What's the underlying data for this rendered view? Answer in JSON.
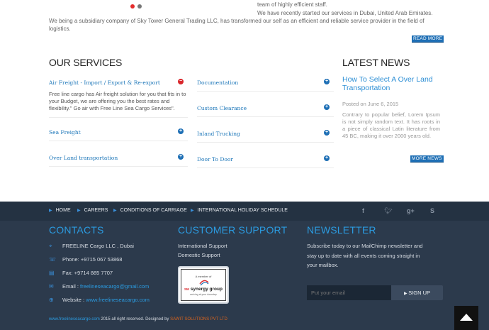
{
  "top": {
    "team_text": "team of highly efficient staff.",
    "about_line1": "We have recently started our services in Dubai, United Arab Emirates.",
    "about_line2": "We being a subsidiary company of Sky Tower General Trading LLC, has transformed our self as an efficient and reliable service provider in the field of logistics.",
    "read_more": "READ MORE"
  },
  "services": {
    "heading": "OUR SERVICES",
    "items": [
      {
        "title": "Air Freight - Import / Export & Re-export",
        "icon": "minus-circle-icon",
        "expanded": true,
        "desc": "Free line cargo has Air freight solution for you that fits in to your Budget, we are offering you the best rates and flexibility.\" Go air with Free Line Sea Cargo Services\"."
      },
      {
        "title": "Documentation",
        "icon": "plus-circle-icon"
      },
      {
        "title": "Custom Clearance",
        "icon": "plus-circle-icon"
      },
      {
        "title": "Sea Freight",
        "icon": "plus-circle-icon"
      },
      {
        "title": "Inland Trucking",
        "icon": "plus-circle-icon"
      },
      {
        "title": "Over Land transportation",
        "icon": "plus-circle-icon"
      },
      {
        "title": "Door To Door",
        "icon": "plus-circle-icon"
      }
    ]
  },
  "news": {
    "heading": "LATEST NEWS",
    "title": "How To Select A Over Land Transportation",
    "date": "Posted on June 6, 2015",
    "text": "Contrary to popular belief, Lorem Ipsum is not simply random text. It has roots in a piece of classical Latin literature from 45 BC, making it over 2000 years old.",
    "more": "MORE NEWS"
  },
  "footer": {
    "nav": [
      "HOME",
      "CAREERS",
      "CONDITIONS OF CARRIAGE",
      "INTERNATIONAL HOLIDAY SCHEDULE"
    ],
    "social_icons": [
      "facebook-icon",
      "twitter-icon",
      "google-plus-icon",
      "skype-icon"
    ],
    "contacts": {
      "heading": "CONTACTS",
      "company": "FREELINE Cargo LLC , Dubai",
      "phone": "Phone: +9715 067 53868",
      "fax": "Fax: +9714 885 7707",
      "email_label": "Email : ",
      "email": "freelineseacargo@gmail.com",
      "website_label": "Website : ",
      "website": "www.freelineseacargo.com"
    },
    "support": {
      "heading": "CUSTOMER SUPPORT",
      "links": [
        "International Support",
        "Domestic Support"
      ],
      "logo_top": "A member of",
      "logo_mark": "SM",
      "logo_name": "synergy group",
      "logo_tag": "arriving at your doorstep"
    },
    "newsletter": {
      "heading": "NEWSLETTER",
      "text": "Subscribe today to our MailChimp newsletter and stay up to date with all events coming straight in your mailbox.",
      "placeholder": "Put your email",
      "button": "SIGN UP"
    },
    "copyright": {
      "site": "www.freelineseacargo.com",
      "text": " 2015 all right reserved. Designed by ",
      "designer": "SAWIT SOLUTIONS PVT LTD"
    }
  },
  "colors": {
    "accent": "#1e6fb5",
    "link": "#2b9be0",
    "footer_bg": "#2c3a4c",
    "minus": "#d9262b"
  }
}
